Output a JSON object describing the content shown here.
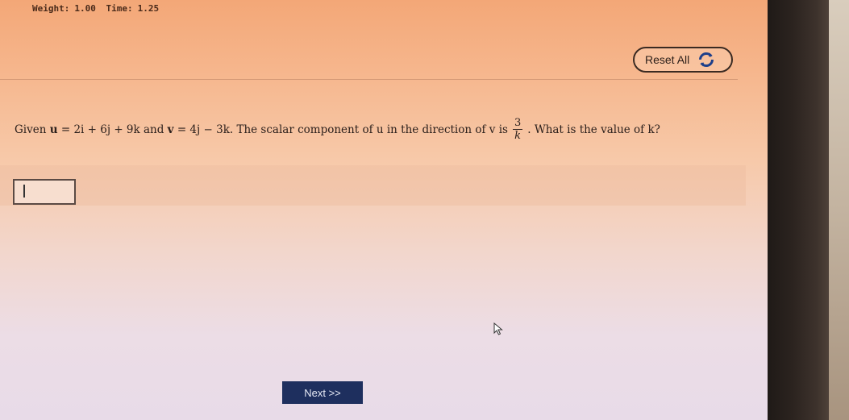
{
  "header": {
    "weight_label": "Weight:",
    "weight_value": "1.00",
    "time_label": "Time:",
    "time_value": "1.25"
  },
  "toolbar": {
    "reset_label": "Reset All",
    "reset_icon": "refresh-icon"
  },
  "question": {
    "given": "Given",
    "u_var": "u",
    "u_expr": "= 2i + 6j + 9k",
    "and": "and",
    "v_var": "v",
    "v_expr": "= 4j − 3k",
    "mid_text": ". The scalar component of u in the direction of v is",
    "fraction_numerator": "3",
    "fraction_denominator": "k",
    "end_text": ". What is the value of k?"
  },
  "answer": {
    "value": "",
    "placeholder": ""
  },
  "navigation": {
    "next_label": "Next >>"
  },
  "colors": {
    "next_button_bg": "#1e2f5e",
    "accent_border": "#3a2a22"
  }
}
